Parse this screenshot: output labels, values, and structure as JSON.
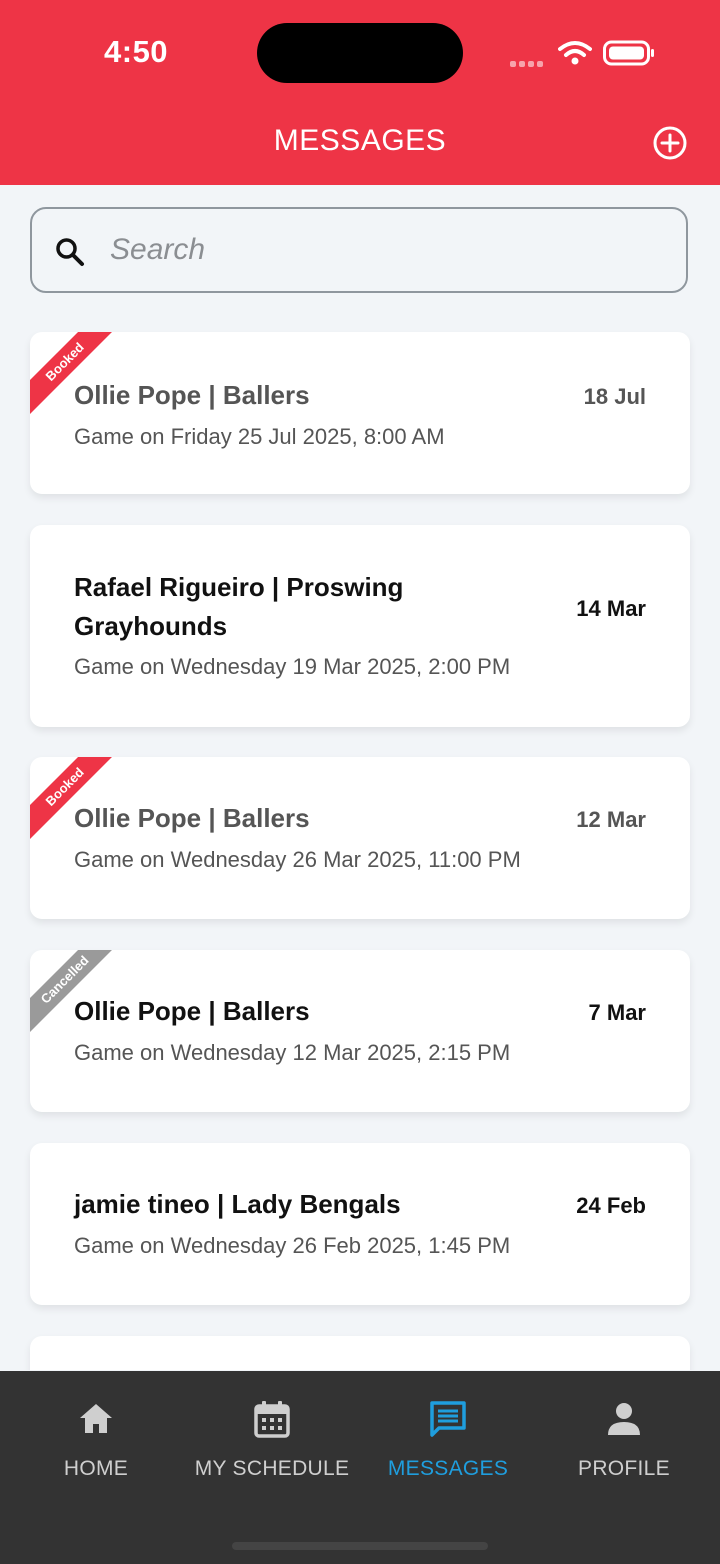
{
  "status_bar": {
    "time": "4:50"
  },
  "header": {
    "title": "MESSAGES",
    "add_icon": "plus-circle-icon"
  },
  "search": {
    "placeholder": "Search",
    "icon": "search-icon"
  },
  "conversations": [
    {
      "badge": "Booked",
      "badge_color": "#ee3446",
      "title": "Ollie Pope | Ballers",
      "subtitle": "Game on Friday 25 Jul 2025, 8:00 AM",
      "date": "18 Jul",
      "read": true
    },
    {
      "badge": "",
      "title": "Rafael Rigueiro | Proswing Grayhounds",
      "subtitle": "Game on Wednesday 19 Mar 2025, 2:00 PM",
      "date": "14 Mar",
      "read": false
    },
    {
      "badge": "Booked",
      "badge_color": "#ee3446",
      "title": "Ollie Pope | Ballers",
      "subtitle": "Game on Wednesday 26 Mar 2025, 11:00 PM",
      "date": "12 Mar",
      "read": true
    },
    {
      "badge": "Cancelled",
      "badge_color": "#9a9a9a",
      "title": "Ollie Pope | Ballers",
      "subtitle": "Game on Wednesday 12 Mar 2025, 2:15 PM",
      "date": "7 Mar",
      "read": false
    },
    {
      "badge": "",
      "title": "jamie tineo | Lady Bengals",
      "subtitle": "Game on Wednesday 26 Feb 2025, 1:45 PM",
      "date": "24 Feb",
      "read": false
    }
  ],
  "bottom_nav": {
    "items": [
      {
        "label": "HOME",
        "icon": "home-icon"
      },
      {
        "label": "MY SCHEDULE",
        "icon": "calendar-icon"
      },
      {
        "label": "MESSAGES",
        "icon": "chat-icon",
        "active": true
      },
      {
        "label": "PROFILE",
        "icon": "person-icon"
      }
    ],
    "active_color": "#1f9ede"
  },
  "colors": {
    "brand": "#ee3446",
    "nav_bg": "#333333"
  }
}
